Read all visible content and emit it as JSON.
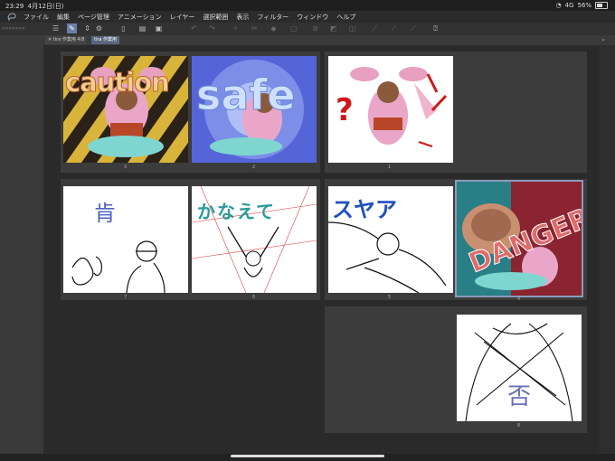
{
  "status": {
    "time": "23:29",
    "date": "4月12日(日)",
    "network": "4G",
    "battery": "56%"
  },
  "menu": [
    "ファイル",
    "編集",
    "ページ管理",
    "アニメーション",
    "レイヤー",
    "選択範囲",
    "表示",
    "フィルター",
    "ウィンドウ",
    "ヘルプ"
  ],
  "tabs": [
    {
      "label": "tira 作業用 4/8"
    },
    {
      "label": "tira 作業用"
    }
  ],
  "pages": [
    {
      "num": "3",
      "text": "caution"
    },
    {
      "num": "2",
      "text": "safe"
    },
    {
      "num": "1",
      "text": "?"
    },
    {
      "num": "7",
      "text": "肯"
    },
    {
      "num": "6",
      "text": "かなえて"
    },
    {
      "num": "5",
      "text": "スヤア"
    },
    {
      "num": "4",
      "text": "DANGER"
    },
    {
      "num": "8",
      "text": "否"
    }
  ]
}
